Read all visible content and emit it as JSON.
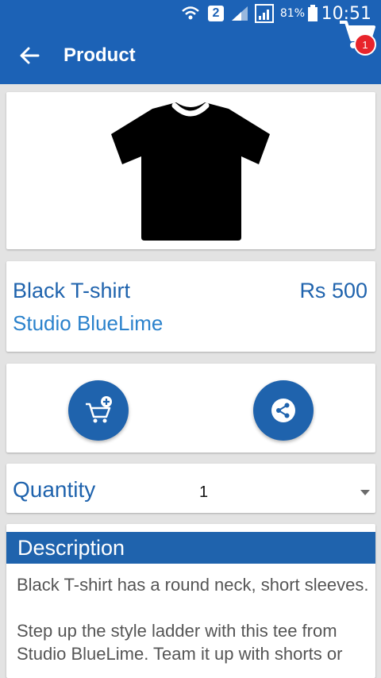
{
  "status_bar": {
    "sim_slot": "2",
    "battery_percent": "81%",
    "time": "10:51"
  },
  "app_bar": {
    "title": "Product",
    "cart_count": "1"
  },
  "product": {
    "name": "Black T-shirt",
    "price": "Rs 500",
    "brand": "Studio BlueLime",
    "image_icon": "tshirt-icon",
    "image_color": "#000000"
  },
  "actions": {
    "add_to_cart_icon": "add-to-cart-icon",
    "share_icon": "share-icon"
  },
  "quantity": {
    "label": "Quantity",
    "value": "1"
  },
  "description": {
    "title": "Description",
    "text": "Black T-shirt has a round neck, short sleeves.\n\nStep up the style ladder with this tee from Studio BlueLime. Team it up with shorts or"
  },
  "colors": {
    "primary": "#1c62b6",
    "accent_text": "#1f63ad",
    "brand_text": "#2b82cc",
    "badge": "#e8242b",
    "background": "#e3e3e3"
  }
}
